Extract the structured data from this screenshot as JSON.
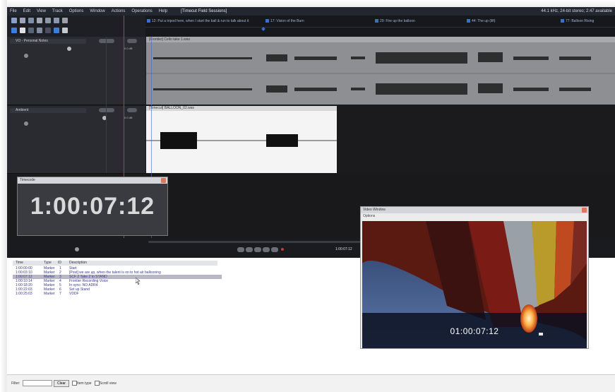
{
  "menubar": {
    "items": [
      "File",
      "Edit",
      "View",
      "Track",
      "Options",
      "Window",
      "Actions",
      "Operations",
      "Help"
    ],
    "project": "[Timecut Field Sessions]",
    "status": "44.1 kHz, 24-bit stereo; 2:47 available"
  },
  "markers": [
    "12: Put a tripod here, when I start the ball & run to talk about it",
    "17: Vision of the Burn",
    "29: Fire up the balloon",
    "44: The up (lift)",
    "77: Balloon Rising"
  ],
  "tracks": [
    {
      "name": "VO - Personal Notes",
      "volume": "0.0 dB",
      "clip": "[Frontier] Cello take 1.wav"
    },
    {
      "name": "Ambient",
      "volume": "0.0 dB",
      "clip": "[Timecut] BALLOON_02.wav"
    }
  ],
  "timecode_window": {
    "title": "Timecode",
    "value": "1:00:07:12"
  },
  "transport": {
    "position_readout": "1:00:07:12"
  },
  "log": {
    "columns": [
      "Time",
      "Type",
      "ID",
      "Description"
    ],
    "rows": [
      {
        "time": "1:00:00:00",
        "type": "Marker",
        "id": "1",
        "desc": "Start"
      },
      {
        "time": "1:00:03:10",
        "type": "Marker",
        "id": "2",
        "desc": "[Post] we are up, when the talent is on to hot air ballooning"
      },
      {
        "time": "1:00:07:12",
        "type": "Marker",
        "id": "3",
        "desc": "SCF 2 Take 2 to STAND"
      },
      {
        "time": "1:00:10:14",
        "type": "Marker",
        "id": "4",
        "desc": "Frontier Recording Voice"
      },
      {
        "time": "1:00:18:20",
        "type": "Marker",
        "id": "5",
        "desc": "In sync: NO ADR4"
      },
      {
        "time": "1:00:22:03",
        "type": "Marker",
        "id": "6",
        "desc": "Set up Stand"
      },
      {
        "time": "1:00:25:03",
        "type": "Marker",
        "id": "7",
        "desc": "VDDF"
      }
    ],
    "selected_row": 2
  },
  "filter": {
    "label": "Filter:",
    "value": "",
    "clear_label": "Clear",
    "option1": "Item type",
    "option2": "Scroll view"
  },
  "video": {
    "title": "Video Window",
    "menu": "Options",
    "timecode": "01:00:07:12"
  },
  "colors": {
    "accent": "#3a6dd1",
    "playhead": "#c23b3b",
    "selected_row": "#b9b7c6"
  }
}
